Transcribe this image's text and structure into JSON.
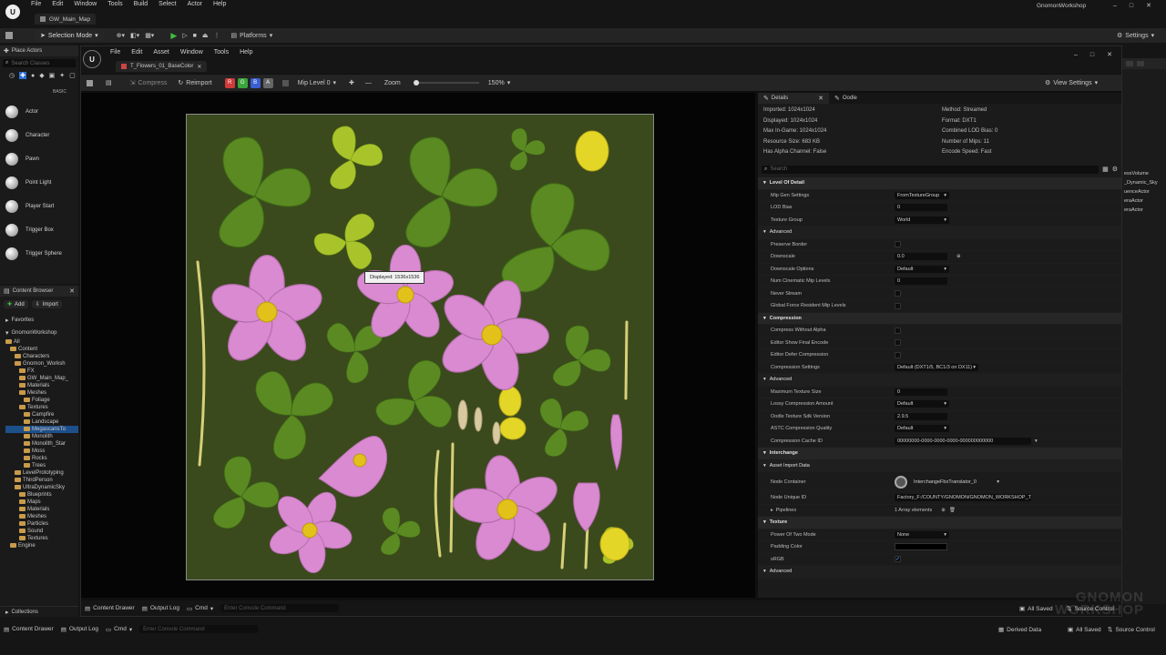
{
  "main_menu": [
    "File",
    "Edit",
    "Window",
    "Tools",
    "Build",
    "Select",
    "Actor",
    "Help"
  ],
  "project_name": "GnomonWorkshop",
  "map_tab": "GW_Main_Map",
  "main_toolbar": {
    "selection_mode": "Selection Mode",
    "platforms": "Platforms",
    "settings": "Settings"
  },
  "place_actors": {
    "tab": "Place Actors",
    "search_placeholder": "Search Classes",
    "category": "BASIC",
    "items": [
      "Actor",
      "Character",
      "Pawn",
      "Point Light",
      "Player Start",
      "Trigger Box",
      "Trigger Sphere"
    ]
  },
  "content_browser": {
    "tab": "Content Browser",
    "add": "Add",
    "import": "Import",
    "favorites": "Favorites",
    "project": "GnomonWorkshop",
    "tree": [
      {
        "label": "All",
        "depth": 0
      },
      {
        "label": "Content",
        "depth": 1
      },
      {
        "label": "Characters",
        "depth": 2
      },
      {
        "label": "Gnomon_Worksh",
        "depth": 2
      },
      {
        "label": "FX",
        "depth": 3
      },
      {
        "label": "GW_Main_Map_",
        "depth": 3
      },
      {
        "label": "Materials",
        "depth": 3
      },
      {
        "label": "Meshes",
        "depth": 3
      },
      {
        "label": "Foliage",
        "depth": 4
      },
      {
        "label": "Textures",
        "depth": 3
      },
      {
        "label": "Campfire",
        "depth": 4
      },
      {
        "label": "Landscape",
        "depth": 4
      },
      {
        "label": "MegascansTo",
        "depth": 4
      },
      {
        "label": "Monolith",
        "depth": 4
      },
      {
        "label": "Monolith_Star",
        "depth": 4
      },
      {
        "label": "Moss",
        "depth": 4
      },
      {
        "label": "Rocks",
        "depth": 4
      },
      {
        "label": "Trees",
        "depth": 4
      },
      {
        "label": "LevelPrototyping",
        "depth": 2
      },
      {
        "label": "ThirdPerson",
        "depth": 2
      },
      {
        "label": "UltraDynamicSky",
        "depth": 2
      },
      {
        "label": "Blueprints",
        "depth": 3
      },
      {
        "label": "Maps",
        "depth": 3
      },
      {
        "label": "Materials",
        "depth": 3
      },
      {
        "label": "Meshes",
        "depth": 3
      },
      {
        "label": "Particles",
        "depth": 3
      },
      {
        "label": "Sound",
        "depth": 3
      },
      {
        "label": "Textures",
        "depth": 3
      },
      {
        "label": "Engine",
        "depth": 1
      }
    ],
    "collections": "Collections"
  },
  "texture_editor": {
    "menu": [
      "File",
      "Edit",
      "Asset",
      "Window",
      "Tools",
      "Help"
    ],
    "tab": "T_Flowers_01_BaseColor",
    "toolbar": {
      "compress": "Compress",
      "reimport": "Reimport",
      "channels": [
        "R",
        "G",
        "B",
        "A"
      ],
      "mip_level": "Mip Level 0",
      "zoom_label": "Zoom",
      "zoom_value": "150%",
      "view_settings": "View Settings"
    },
    "tooltip": "Displayed: 1536x1536",
    "details_tab": "Details",
    "oodle_tab": "Oodle",
    "info_left": [
      "Imported: 1024x1024",
      "Displayed: 1024x1024",
      "Max In-Game: 1024x1024",
      "Resource Size: 683 KB",
      "Has Alpha Channel: False"
    ],
    "info_right": [
      "Method: Streamed",
      "Format: DXT1",
      "Combined LOD Bias: 0",
      "Number of Mips: 11",
      "Encode Speed: Fast"
    ],
    "search_placeholder": "Search",
    "rows": [
      {
        "type": "section",
        "label": "Level Of Detail"
      },
      {
        "type": "select",
        "label": "Mip Gen Settings",
        "value": "FromTextureGroup"
      },
      {
        "type": "number",
        "label": "LOD Bias",
        "value": "0"
      },
      {
        "type": "select",
        "label": "Texture Group",
        "value": "World"
      },
      {
        "type": "subsection",
        "label": "Advanced"
      },
      {
        "type": "check",
        "label": "Preserve Border",
        "value": ""
      },
      {
        "type": "number",
        "label": "Downscale",
        "value": "0.0"
      },
      {
        "type": "select",
        "label": "Downscale Options",
        "value": "Default"
      },
      {
        "type": "number",
        "label": "Num Cinematic Mip Levels",
        "value": "0"
      },
      {
        "type": "check",
        "label": "Never Stream",
        "value": ""
      },
      {
        "type": "check",
        "label": "Global Force Resident Mip Levels",
        "value": ""
      },
      {
        "type": "section",
        "label": "Compression"
      },
      {
        "type": "check",
        "label": "Compress Without Alpha",
        "value": ""
      },
      {
        "type": "check",
        "label": "Editor Show Final Encode",
        "value": ""
      },
      {
        "type": "check",
        "label": "Editor Defer Compression",
        "value": ""
      },
      {
        "type": "select",
        "label": "Compression Settings",
        "value": "Default (DXT1/5, BC1/3 on DX11)"
      },
      {
        "type": "subsection",
        "label": "Advanced"
      },
      {
        "type": "number",
        "label": "Maximum Texture Size",
        "value": "0"
      },
      {
        "type": "select",
        "label": "Lossy Compression Amount",
        "value": "Default"
      },
      {
        "type": "number",
        "label": "Oodle Texture Sdk Version",
        "value": "2.9.5"
      },
      {
        "type": "select",
        "label": "ASTC Compression Quality",
        "value": "Default"
      },
      {
        "type": "number",
        "label": "Compression Cache ID",
        "value": "00000000-0000-0000-0000-000000000000"
      },
      {
        "type": "section",
        "label": "Interchange"
      },
      {
        "type": "subsection",
        "label": "Asset Import Data"
      },
      {
        "type": "node",
        "label": "Node Container",
        "value": "InterchangeFbxTranslator_0"
      },
      {
        "type": "number",
        "label": "Node Unique ID",
        "value": "Factory_F:/COUNTY/GNOMON/GNOMON_WORKSHOP_TUTORIAL_02/GnomonWork"
      },
      {
        "type": "pipelines",
        "label": "Pipelines",
        "value": "1 Array elements"
      },
      {
        "type": "section",
        "label": "Texture"
      },
      {
        "type": "select",
        "label": "Power Of Two Mode",
        "value": "None"
      },
      {
        "type": "color",
        "label": "Padding Color",
        "value": ""
      },
      {
        "type": "checkon",
        "label": "sRGB",
        "value": "✓"
      },
      {
        "type": "subsection",
        "label": "Advanced"
      }
    ]
  },
  "inner_status": {
    "content_drawer": "Content Drawer",
    "output_log": "Output Log",
    "cmd": "Cmd",
    "console_placeholder": "Enter Console Command",
    "all_saved": "All Saved",
    "source_control": "Source Control"
  },
  "outer_status": {
    "content_drawer": "Content Drawer",
    "output_log": "Output Log",
    "cmd": "Cmd",
    "console_placeholder": "Enter Console Command",
    "derived_data": "Derived Data",
    "all_saved": "All Saved",
    "source_control": "Source Control"
  },
  "outliner_fragments": [
    "essVolume",
    "_Dynamic_Sky",
    "uenceActor",
    "eraActor",
    "eraActor"
  ],
  "watermark": "GNOMON WORKSHOP",
  "colors": {
    "texture_bg": "#3a4a1c",
    "accent": "#4aa3ff",
    "flower": "#d98ad0",
    "flower_center": "#e2c21a",
    "leaf": "#5e8a22"
  }
}
